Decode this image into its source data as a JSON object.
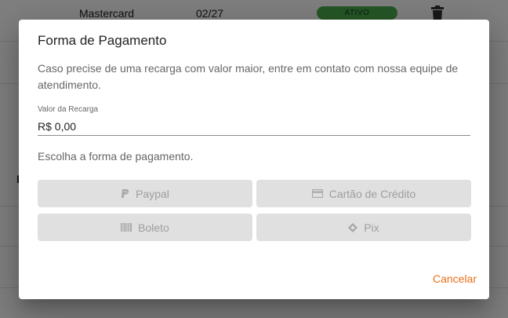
{
  "background": {
    "row": {
      "brand": "Mastercard",
      "expiry": "02/27",
      "status": "ATIVO"
    },
    "partial_letter": "I"
  },
  "dialog": {
    "title": "Forma de Pagamento",
    "description": "Caso precise de uma recarga com valor maior, entre em contato com nossa equipe de atendimento.",
    "amount_field": {
      "label": "Valor da Recarga",
      "value": "R$ 0,00"
    },
    "choose_text": "Escolha a forma de pagamento.",
    "payment_methods": [
      {
        "label": "Paypal",
        "icon": "paypal-icon"
      },
      {
        "label": "Cartão de Crédito",
        "icon": "credit-card-icon"
      },
      {
        "label": "Boleto",
        "icon": "barcode-icon"
      },
      {
        "label": "Pix",
        "icon": "pix-icon"
      }
    ],
    "cancel_label": "Cancelar"
  },
  "colors": {
    "accent": "#e8711a",
    "status_active": "#4caf50",
    "button_disabled_bg": "#e0e0e0",
    "button_disabled_text": "#9e9e9e"
  }
}
